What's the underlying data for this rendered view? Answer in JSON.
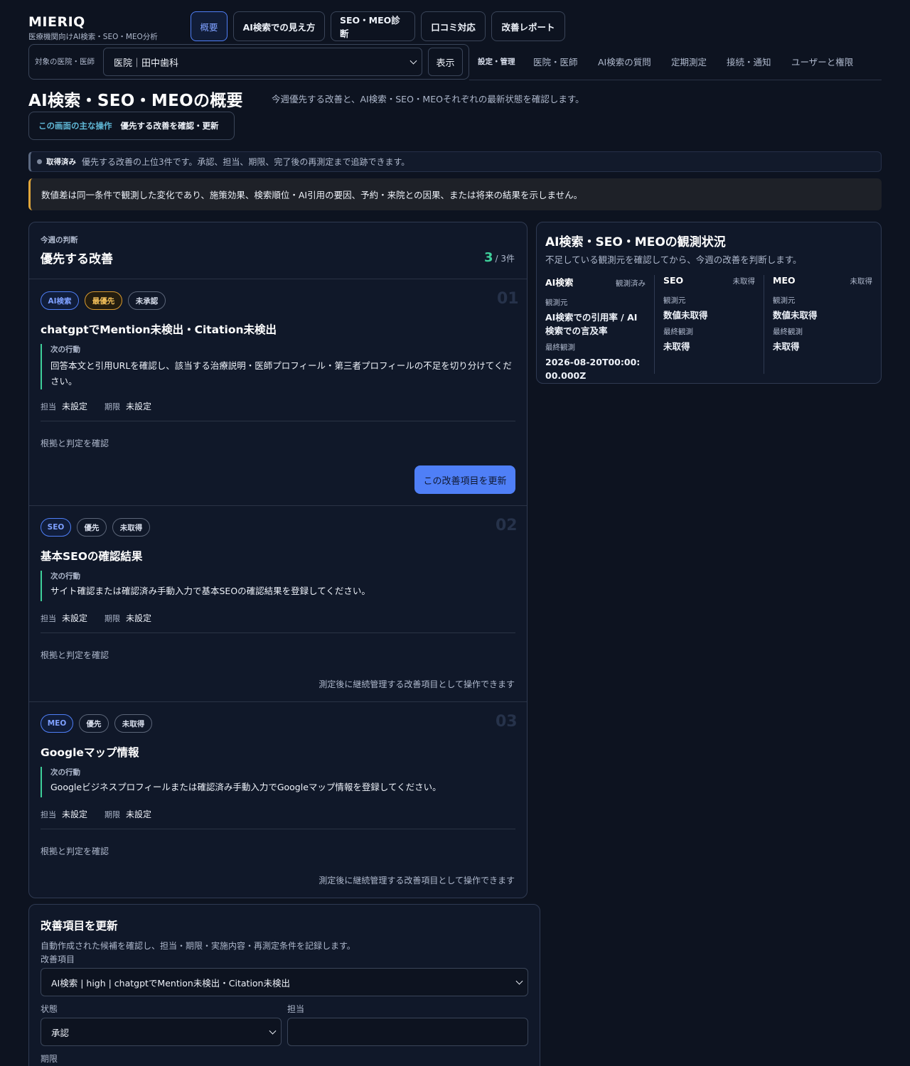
{
  "brand": {
    "name": "MIERIQ",
    "subtitle": "医療機関向けAI検索・SEO・MEO分析"
  },
  "nav": {
    "tabs": [
      {
        "label": "概要",
        "active": true
      },
      {
        "label": "AI検索での見え方"
      },
      {
        "label": "SEO・MEO診断"
      },
      {
        "label": "口コミ対応"
      },
      {
        "label": "改善レポート"
      }
    ],
    "target_label": "対象の医院・医師",
    "target_value": "医院｜田中歯科",
    "show_button": "表示",
    "settings_label": "設定・管理",
    "settings_links": [
      "医院・医師",
      "AI検索の質問",
      "定期測定",
      "接続・通知",
      "ユーザーと権限"
    ]
  },
  "page": {
    "title": "AI検索・SEO・MEOの概要",
    "description": "今週優先する改善と、AI検索・SEO・MEOそれぞれの最新状態を確認します。",
    "main_op_key": "この画面の主な操作",
    "main_op_value": "優先する改善を確認・更新"
  },
  "status": {
    "key": "取得済み",
    "text": "優先する改善の上位3件です。承認、担当、期限、完了後の再測定まで追跡できます。"
  },
  "warning": "数値差は同一条件で観測した変化であり、施策効果、検索順位・AI引用の要因、予約・来院との因果、または将来の結果を示しません。",
  "priority": {
    "kicker": "今週の判断",
    "title": "優先する改善",
    "count": "3",
    "count_total": "/ 3件",
    "next_action_label": "次の行動",
    "owner_label": "担当",
    "due_label": "期限",
    "evidence_label": "根拠と判定を確認",
    "items": [
      {
        "num": "01",
        "chips": [
          "AI検索",
          "最優先",
          "未承認"
        ],
        "title": "chatgptでMention未検出・Citation未検出",
        "action": "回答本文と引用URLを確認し、該当する治療説明・医師プロフィール・第三者プロフィールの不足を切り分けてください。",
        "owner": "未設定",
        "due": "未設定",
        "button": "この改善項目を更新"
      },
      {
        "num": "02",
        "chips": [
          "SEO",
          "優先",
          "未取得"
        ],
        "title": "基本SEOの確認結果",
        "action": "サイト確認または確認済み手動入力で基本SEOの確認結果を登録してください。",
        "owner": "未設定",
        "due": "未設定",
        "note": "測定後に継続管理する改善項目として操作できます"
      },
      {
        "num": "03",
        "chips": [
          "MEO",
          "優先",
          "未取得"
        ],
        "title": "Googleマップ情報",
        "action": "Googleビジネスプロフィールまたは確認済み手動入力でGoogleマップ情報を登録してください。",
        "owner": "未設定",
        "due": "未設定",
        "note": "測定後に継続管理する改善項目として操作できます"
      }
    ]
  },
  "observation": {
    "title": "AI検索・SEO・MEOの観測状況",
    "description": "不足している観測元を確認してから、今週の改善を判断します。",
    "source_label": "観測元",
    "last_label": "最終観測",
    "columns": [
      {
        "name": "AI検索",
        "status": "観測済み",
        "source": "AI検索での引用率 / AI検索での言及率",
        "last": "2026-08-20T00:00:00.000Z"
      },
      {
        "name": "SEO",
        "status": "未取得",
        "source": "数値未取得",
        "last": "未取得"
      },
      {
        "name": "MEO",
        "status": "未取得",
        "source": "数値未取得",
        "last": "未取得"
      }
    ]
  },
  "form": {
    "title": "改善項目を更新",
    "description": "自動作成された候補を確認し、担当・期限・実施内容・再測定条件を記録します。",
    "item_label": "改善項目",
    "item_value": "AI検索 | high | chatgptでMention未検出・Citation未検出",
    "state_label": "状態",
    "state_value": "承認",
    "owner_label": "担当",
    "owner_value": "",
    "due_label": "期限"
  },
  "colors": {
    "accent": "#4f7ff7",
    "success": "#3ecf9a",
    "warning": "#e0a63b",
    "background": "#0d1320"
  }
}
